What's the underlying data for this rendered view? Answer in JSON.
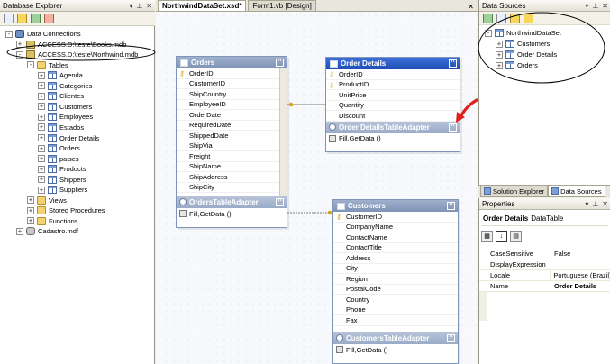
{
  "db_explorer": {
    "title": "Database Explorer",
    "tree": [
      {
        "label": "Data Connections",
        "level": 0,
        "expander": "-",
        "icon": "conn"
      },
      {
        "label": "ACCESS.D:\\teste\\Books.mdb",
        "level": 1,
        "expander": "+",
        "icon": "acc"
      },
      {
        "label": "ACCESS.D:\\teste\\Northwind.mdb",
        "level": 1,
        "expander": "-",
        "icon": "acc"
      },
      {
        "label": "Tables",
        "level": 2,
        "expander": "-",
        "icon": "folder"
      },
      {
        "label": "Agenda",
        "level": 3,
        "expander": "+",
        "icon": "tbl"
      },
      {
        "label": "Categories",
        "level": 3,
        "expander": "+",
        "icon": "tbl"
      },
      {
        "label": "Clientes",
        "level": 3,
        "expander": "+",
        "icon": "tbl"
      },
      {
        "label": "Customers",
        "level": 3,
        "expander": "+",
        "icon": "tbl"
      },
      {
        "label": "Employees",
        "level": 3,
        "expander": "+",
        "icon": "tbl"
      },
      {
        "label": "Estados",
        "level": 3,
        "expander": "+",
        "icon": "tbl"
      },
      {
        "label": "Order Details",
        "level": 3,
        "expander": "+",
        "icon": "tbl"
      },
      {
        "label": "Orders",
        "level": 3,
        "expander": "+",
        "icon": "tbl"
      },
      {
        "label": "paises",
        "level": 3,
        "expander": "+",
        "icon": "tbl"
      },
      {
        "label": "Products",
        "level": 3,
        "expander": "+",
        "icon": "tbl"
      },
      {
        "label": "Shippers",
        "level": 3,
        "expander": "+",
        "icon": "tbl"
      },
      {
        "label": "Suppliers",
        "level": 3,
        "expander": "+",
        "icon": "tbl"
      },
      {
        "label": "Views",
        "level": 2,
        "expander": "+",
        "icon": "folder"
      },
      {
        "label": "Stored Procedures",
        "level": 2,
        "expander": "+",
        "icon": "folder"
      },
      {
        "label": "Functions",
        "level": 2,
        "expander": "+",
        "icon": "folder"
      },
      {
        "label": "Cadastro.mdf",
        "level": 1,
        "expander": "+",
        "icon": "mdf"
      }
    ]
  },
  "tabs": [
    {
      "label": "NorthwindDataSet.xsd*",
      "active": true
    },
    {
      "label": "Form1.vb [Design]",
      "active": false
    }
  ],
  "tables": {
    "orders": {
      "title": "Orders",
      "columns": [
        "OrderID",
        "CustomerID",
        "ShipCountry",
        "EmployeeID",
        "OrderDate",
        "RequiredDate",
        "ShippedDate",
        "ShipVia",
        "Freight",
        "ShipName",
        "ShipAddress",
        "ShipCity"
      ],
      "key_index": 0,
      "adapter": "OrdersTableAdapter",
      "query": "Fill,GetData ()"
    },
    "order_details": {
      "title": "Order Details",
      "columns": [
        "OrderID",
        "ProductID",
        "UnitPrice",
        "Quantity",
        "Discount"
      ],
      "key_indices": [
        0,
        1
      ],
      "adapter": "Order DetailsTableAdapter",
      "query": "Fill,GetData ()"
    },
    "customers": {
      "title": "Customers",
      "columns": [
        "CustomerID",
        "CompanyName",
        "ContactName",
        "ContactTitle",
        "Address",
        "City",
        "Region",
        "PostalCode",
        "Country",
        "Phone",
        "Fax"
      ],
      "key_index": 0,
      "adapter": "CustomersTableAdapter",
      "query": "Fill,GetData ()"
    }
  },
  "data_sources": {
    "title": "Data Sources",
    "root": "NorthwindDataSet",
    "items": [
      "Customers",
      "Order Details",
      "Orders"
    ]
  },
  "right_tabs": [
    {
      "label": "Solution Explorer",
      "active": false
    },
    {
      "label": "Data Sources",
      "active": true
    }
  ],
  "properties": {
    "title": "Properties",
    "object_name": "Order Details",
    "object_type": "DataTable",
    "rows": [
      {
        "name": "CaseSensitive",
        "value": "False"
      },
      {
        "name": "DisplayExpression",
        "value": ""
      },
      {
        "name": "Locale",
        "value": "Portuguese (Brazil)"
      },
      {
        "name": "Name",
        "value": "Order Details",
        "selected": true
      }
    ]
  },
  "colors": {
    "annotation_arrow": "#e0201c",
    "selected_header": "#1f4fb4",
    "header": "#8195b8"
  }
}
